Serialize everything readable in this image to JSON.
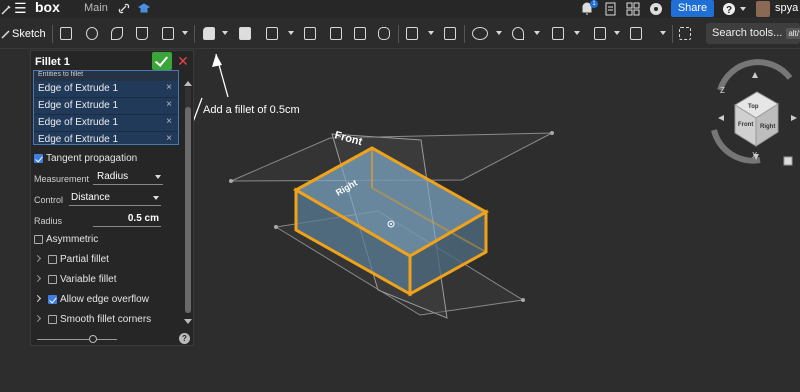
{
  "topbar": {
    "app_name": "box",
    "tab": "Main",
    "share_label": "Share",
    "notification_count": "1",
    "user": "spya"
  },
  "toolbar": {
    "sketch_label": "Sketch",
    "search_label": "Search tools...",
    "search_shortcut": "alt/⌥"
  },
  "fillet_panel": {
    "title": "Fillet 1",
    "entities_label": "Entities to fillet",
    "entities": [
      "Edge of Extrude 1",
      "Edge of Extrude 1",
      "Edge of Extrude 1",
      "Edge of Extrude 1"
    ],
    "remove_glyph": "×",
    "tangent_propagation": {
      "label": "Tangent propagation",
      "checked": true
    },
    "measurement": {
      "label": "Measurement",
      "value": "Radius"
    },
    "control": {
      "label": "Control",
      "value": "Distance"
    },
    "radius": {
      "label": "Radius",
      "value": "0.5 cm"
    },
    "asymmetric": {
      "label": "Asymmetric",
      "checked": false
    },
    "partial_fillet": {
      "label": "Partial fillet",
      "checked": false
    },
    "variable_fillet": {
      "label": "Variable fillet",
      "checked": false
    },
    "allow_edge_overflow": {
      "label": "Allow edge overflow",
      "checked": true
    },
    "smooth_fillet_corners": {
      "label": "Smooth fillet corners",
      "checked": false
    },
    "help_glyph": "?"
  },
  "annotation": {
    "text": "Add a fillet of 0.5cm"
  },
  "viewport": {
    "plane_front_label": "Front",
    "plane_right_label": "Right"
  },
  "view_cube": {
    "top": "Top",
    "front": "Front",
    "right": "Right",
    "axis_z": "Z",
    "axis_x": "X"
  },
  "colors": {
    "accent": "#f0a21a",
    "selection": "#223a5a",
    "share": "#1f6fd6",
    "ok": "#3aa63a"
  }
}
